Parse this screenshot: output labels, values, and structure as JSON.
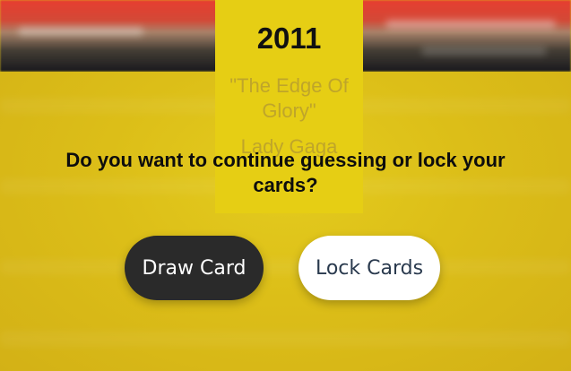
{
  "card": {
    "year": "2011",
    "song": "\"The Edge Of Glory\"",
    "artist": "Lady Gaga"
  },
  "prompt": {
    "question": "Do you want to continue guessing or lock your cards?"
  },
  "actions": {
    "draw_label": "Draw Card",
    "lock_label": "Lock Cards"
  },
  "colors": {
    "background_yellow": "#dcbc18",
    "card_yellow": "#e6ce14",
    "draw_button": "#2a2a2a",
    "lock_button": "#ffffff"
  }
}
